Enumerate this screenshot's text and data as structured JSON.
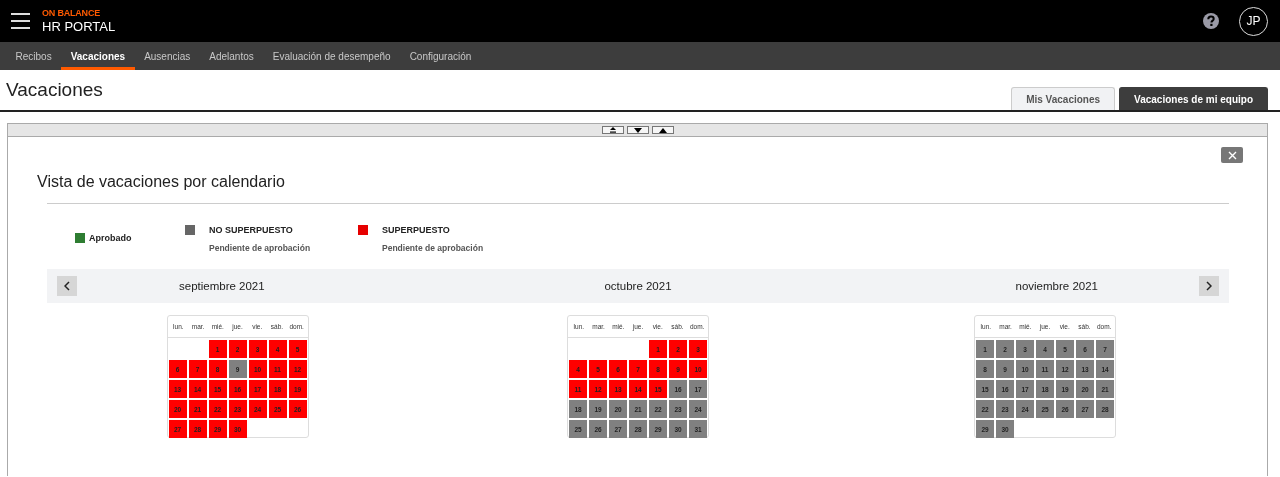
{
  "header": {
    "brand_top": "ON BALANCE",
    "brand_name": "HR PORTAL",
    "avatar_initials": "JP"
  },
  "nav": [
    {
      "label": "Recibos",
      "selected": false
    },
    {
      "label": "Vacaciones",
      "selected": true
    },
    {
      "label": "Ausencias",
      "selected": false
    },
    {
      "label": "Adelantos",
      "selected": false
    },
    {
      "label": "Evaluación de desempeño",
      "selected": false
    },
    {
      "label": "Configuración",
      "selected": false
    }
  ],
  "page": {
    "title": "Vacaciones",
    "tabs": [
      {
        "label": "Mis Vacaciones",
        "selected": false
      },
      {
        "label": "Vacaciones de mi equipo",
        "selected": true
      }
    ]
  },
  "panel": {
    "title": "Vista de vacaciones por calendario",
    "legend": [
      {
        "label": "Aprobado",
        "color": "#2e7d32"
      },
      {
        "label": "NO SUPERPUESTO",
        "sublabel": "Pendiente de aprobación",
        "color": "#666666"
      },
      {
        "label": "SUPERPUESTO",
        "sublabel": "Pendiente de aprobación",
        "color": "#e60000"
      }
    ],
    "months": [
      {
        "title": "septiembre 2021",
        "weekdays": [
          "lun.",
          "mar.",
          "mié.",
          "jue.",
          "vie.",
          "sáb.",
          "dom."
        ],
        "weeks": [
          [
            {
              "day": "1",
              "color": "#ff0000"
            },
            {
              "day": "2",
              "color": "#ff0000"
            },
            {
              "day": "3",
              "color": "#ff0000"
            },
            {
              "day": "4",
              "color": "#ff0000"
            },
            {
              "day": "5",
              "color": "#ff0000"
            }
          ],
          [
            {
              "day": "6",
              "color": "#ff0000"
            },
            {
              "day": "7",
              "color": "#ff0000"
            },
            {
              "day": "8",
              "color": "#ff0000"
            },
            {
              "day": "9",
              "color": "#808080"
            },
            {
              "day": "10",
              "color": "#ff0000"
            },
            {
              "day": "11",
              "color": "#ff0000"
            },
            {
              "day": "12",
              "color": "#ff0000"
            }
          ],
          [
            {
              "day": "13",
              "color": "#ff0000"
            },
            {
              "day": "14",
              "color": "#ff0000"
            },
            {
              "day": "15",
              "color": "#ff0000"
            },
            {
              "day": "16",
              "color": "#ff0000"
            },
            {
              "day": "17",
              "color": "#ff0000"
            },
            {
              "day": "18",
              "color": "#ff0000"
            },
            {
              "day": "19",
              "color": "#ff0000"
            }
          ],
          [
            {
              "day": "20",
              "color": "#ff0000"
            },
            {
              "day": "21",
              "color": "#ff0000"
            },
            {
              "day": "22",
              "color": "#ff0000"
            },
            {
              "day": "23",
              "color": "#ff0000"
            },
            {
              "day": "24",
              "color": "#ff0000"
            },
            {
              "day": "25",
              "color": "#ff0000"
            },
            {
              "day": "26",
              "color": "#ff0000"
            }
          ],
          [
            {
              "day": "27",
              "color": "#ff0000"
            },
            {
              "day": "28",
              "color": "#ff0000"
            },
            {
              "day": "29",
              "color": "#ff0000"
            },
            {
              "day": "30",
              "color": "#ff0000"
            }
          ]
        ]
      },
      {
        "title": "octubre 2021",
        "weekdays": [
          "lun.",
          "mar.",
          "mié.",
          "jue.",
          "vie.",
          "sáb.",
          "dom."
        ],
        "weeks": [
          [
            {
              "day": "1",
              "color": "#ff0000"
            },
            {
              "day": "2",
              "color": "#ff0000"
            },
            {
              "day": "3",
              "color": "#ff0000"
            }
          ],
          [
            {
              "day": "4",
              "color": "#ff0000"
            },
            {
              "day": "5",
              "color": "#ff0000"
            },
            {
              "day": "6",
              "color": "#ff0000"
            },
            {
              "day": "7",
              "color": "#ff0000"
            },
            {
              "day": "8",
              "color": "#ff0000"
            },
            {
              "day": "9",
              "color": "#ff0000"
            },
            {
              "day": "10",
              "color": "#ff0000"
            }
          ],
          [
            {
              "day": "11",
              "color": "#ff0000"
            },
            {
              "day": "12",
              "color": "#ff0000"
            },
            {
              "day": "13",
              "color": "#ff0000"
            },
            {
              "day": "14",
              "color": "#ff0000"
            },
            {
              "day": "15",
              "color": "#ff0000"
            },
            {
              "day": "16",
              "color": "#808080"
            },
            {
              "day": "17",
              "color": "#808080"
            }
          ],
          [
            {
              "day": "18",
              "color": "#808080"
            },
            {
              "day": "19",
              "color": "#808080"
            },
            {
              "day": "20",
              "color": "#808080"
            },
            {
              "day": "21",
              "color": "#808080"
            },
            {
              "day": "22",
              "color": "#808080"
            },
            {
              "day": "23",
              "color": "#808080"
            },
            {
              "day": "24",
              "color": "#808080"
            }
          ],
          [
            {
              "day": "25",
              "color": "#808080"
            },
            {
              "day": "26",
              "color": "#808080"
            },
            {
              "day": "27",
              "color": "#808080"
            },
            {
              "day": "28",
              "color": "#808080"
            },
            {
              "day": "29",
              "color": "#808080"
            },
            {
              "day": "30",
              "color": "#808080"
            },
            {
              "day": "31",
              "color": "#808080"
            }
          ]
        ]
      },
      {
        "title": "noviembre 2021",
        "weekdays": [
          "lun.",
          "mar.",
          "mié.",
          "jue.",
          "vie.",
          "sáb.",
          "dom."
        ],
        "weeks": [
          [
            {
              "day": "1",
              "color": "#808080"
            },
            {
              "day": "2",
              "color": "#808080"
            },
            {
              "day": "3",
              "color": "#808080"
            },
            {
              "day": "4",
              "color": "#808080"
            },
            {
              "day": "5",
              "color": "#808080"
            },
            {
              "day": "6",
              "color": "#808080"
            },
            {
              "day": "7",
              "color": "#808080"
            }
          ],
          [
            {
              "day": "8",
              "color": "#808080"
            },
            {
              "day": "9",
              "color": "#808080"
            },
            {
              "day": "10",
              "color": "#808080"
            },
            {
              "day": "11",
              "color": "#808080"
            },
            {
              "day": "12",
              "color": "#808080"
            },
            {
              "day": "13",
              "color": "#808080"
            },
            {
              "day": "14",
              "color": "#808080"
            }
          ],
          [
            {
              "day": "15",
              "color": "#808080"
            },
            {
              "day": "16",
              "color": "#808080"
            },
            {
              "day": "17",
              "color": "#808080"
            },
            {
              "day": "18",
              "color": "#808080"
            },
            {
              "day": "19",
              "color": "#808080"
            },
            {
              "day": "20",
              "color": "#808080"
            },
            {
              "day": "21",
              "color": "#808080"
            }
          ],
          [
            {
              "day": "22",
              "color": "#808080"
            },
            {
              "day": "23",
              "color": "#808080"
            },
            {
              "day": "24",
              "color": "#808080"
            },
            {
              "day": "25",
              "color": "#808080"
            },
            {
              "day": "26",
              "color": "#808080"
            },
            {
              "day": "27",
              "color": "#808080"
            },
            {
              "day": "28",
              "color": "#808080"
            }
          ],
          [
            {
              "day": "29",
              "color": "#808080"
            },
            {
              "day": "30",
              "color": "#808080"
            }
          ]
        ]
      }
    ]
  }
}
